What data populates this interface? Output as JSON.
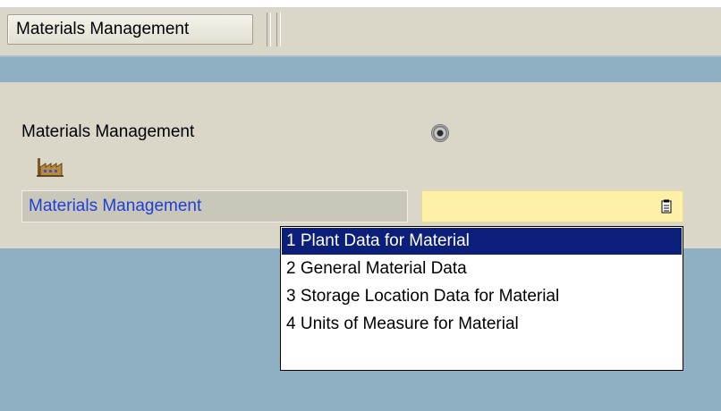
{
  "toolbar": {
    "button_label": "Materials Management"
  },
  "form": {
    "row_label": "Materials Management",
    "field_label": "Materials Management",
    "field_value": ""
  },
  "dropdown": {
    "options": [
      "1 Plant Data for Material",
      "2 General Material Data",
      "3 Storage Location Data for Material",
      "4 Units of Measure for Material"
    ],
    "selected_index": 0
  },
  "icons": {
    "factory": "factory-icon",
    "value_help": "value-help-icon",
    "radio": "radio-button"
  },
  "colors": {
    "panel": "#dad7c9",
    "blue_area": "#8fafc3",
    "input_bg": "#fff0a8",
    "selection": "#0a1e7a",
    "link_text": "#1f3fd6"
  }
}
